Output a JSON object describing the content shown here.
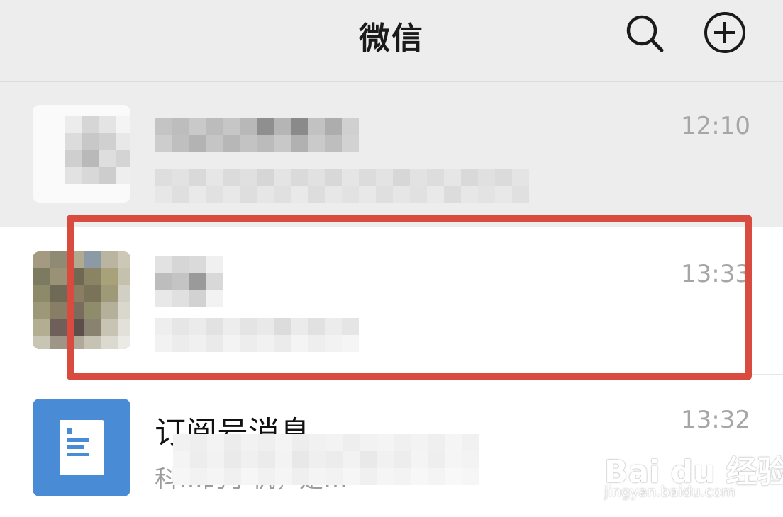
{
  "header": {
    "title": "微信",
    "icons": [
      "search-icon",
      "add-icon"
    ]
  },
  "chats": [
    {
      "name": "",
      "preview": "",
      "time": "12:10",
      "pinned": true,
      "obscured": true
    },
    {
      "name": "",
      "preview": "",
      "time": "13:33",
      "obscured": true,
      "highlighted": true
    },
    {
      "name": "订阅号消息",
      "preview": "科…的手机，是…",
      "time": "13:32",
      "icon": "document-icon"
    }
  ],
  "watermark": {
    "logo": "Bai du 经验",
    "url": "jingyan.baidu.com"
  },
  "colors": {
    "header_bg": "#ededed",
    "pinned_bg": "#ededed",
    "highlight": "#d84b3e",
    "subscription_icon": "#4a8bd6"
  }
}
